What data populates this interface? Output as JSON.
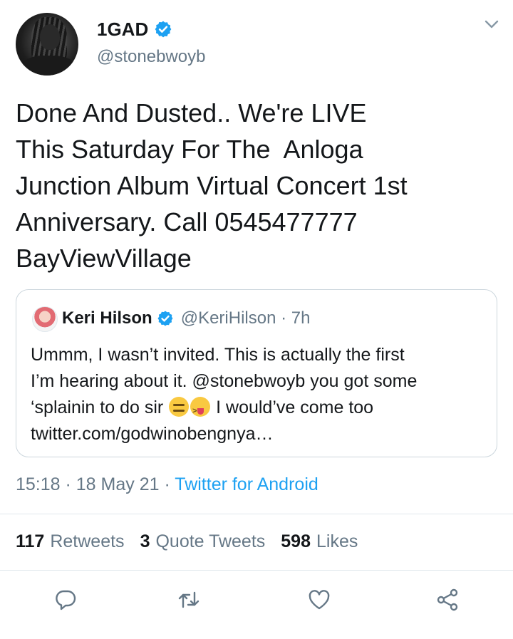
{
  "author": {
    "name": "1GAD",
    "handle": "@stonebwoyb"
  },
  "tweet": {
    "text": "Done And Dusted.. We're LIVE\nThis Saturday For The  Anloga\nJunction Album Virtual Concert 1st\nAnniversary. Call 0545477777\nBayViewVillage"
  },
  "quoted": {
    "name": "Keri Hilson",
    "handle": "@KeriHilson",
    "time": "7h",
    "text_line1": "Ummm, I wasn’t invited. This is actually the first",
    "text_line2": "I’m hearing about it. @stonebwoyb you got some",
    "text_line3a": "‘splainin to do sir",
    "text_line3b": "I would’ve come too",
    "text_line4": "twitter.com/godwinobengnya…"
  },
  "meta": {
    "time": "15:18",
    "date": "18 May 21",
    "source": "Twitter for Android"
  },
  "stats": {
    "retweets_count": "117",
    "retweets_label": "Retweets",
    "quotes_count": "3",
    "quotes_label": "Quote Tweets",
    "likes_count": "598",
    "likes_label": "Likes"
  },
  "colors": {
    "accent": "#1da1f2",
    "secondary_text": "#657786",
    "border": "#ccd6dd"
  }
}
